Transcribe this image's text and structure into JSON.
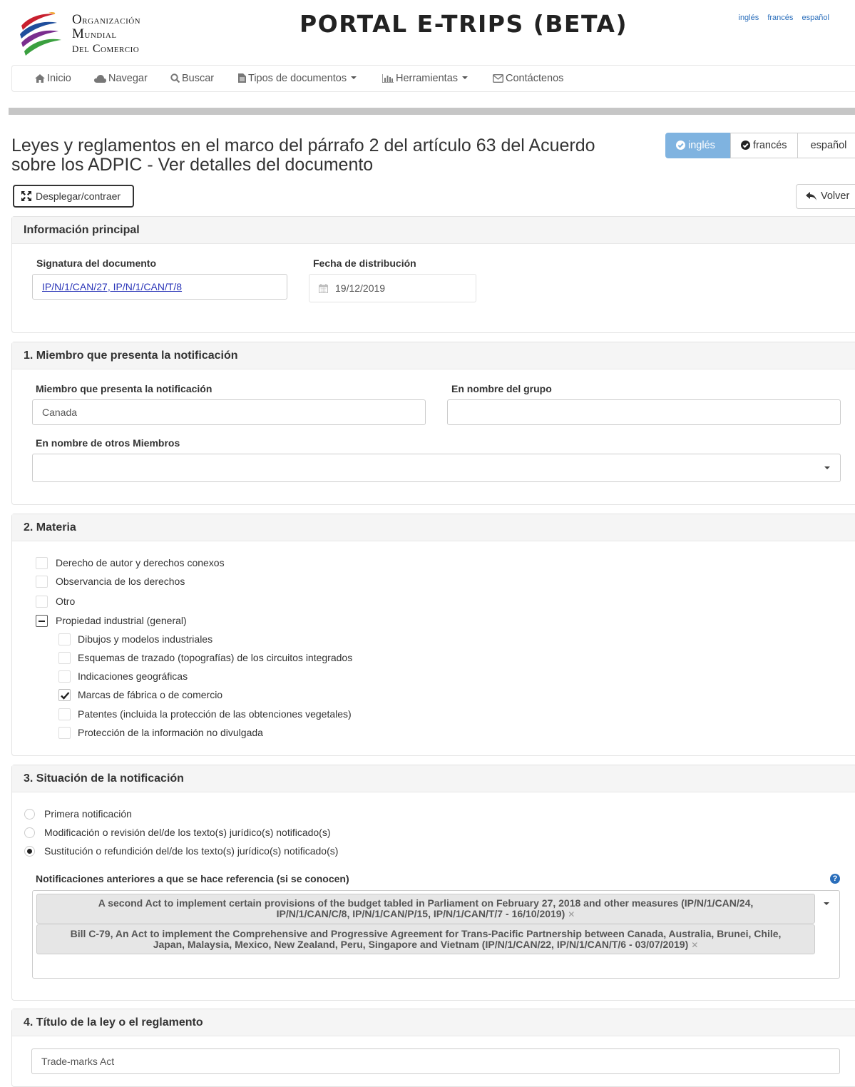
{
  "header": {
    "org_line1": "Organización",
    "org_line2": "Mundial",
    "org_line3": "del Comercio",
    "portal_title": "PORTAL E-TRIPS (BETA)",
    "top_languages": [
      "inglés",
      "francés",
      "español"
    ]
  },
  "nav": {
    "home": "Inicio",
    "browse": "Navegar",
    "search": "Buscar",
    "doc_types": "Tipos de documentos",
    "tools": "Herramientas",
    "contact": "Contáctenos"
  },
  "page": {
    "title": "Leyes y reglamentos en el marco del párrafo 2 del artículo 63 del Acuerdo sobre los ADPIC - Ver detalles del documento",
    "lang_buttons": {
      "english": "inglés",
      "french": "francés",
      "spanish": "español"
    },
    "toggle_button": "Desplegar/contraer",
    "back_button": "Volver"
  },
  "main_info": {
    "heading": "Información principal",
    "signature_label": "Signatura del documento",
    "signature_value": "IP/N/1/CAN/27, IP/N/1/CAN/T/8",
    "date_label": "Fecha de distribución",
    "date_value": "19/12/2019"
  },
  "section1": {
    "heading": "1. Miembro que presenta la notificación",
    "member_label": "Miembro que presenta la notificación",
    "member_value": "Canada",
    "group_label": "En nombre del grupo",
    "group_value": "",
    "others_label": "En nombre de otros Miembros",
    "others_value": ""
  },
  "section2": {
    "heading": "2. Materia",
    "items": [
      {
        "label": "Derecho de autor y derechos conexos",
        "state": "unchecked"
      },
      {
        "label": "Observancia de los derechos",
        "state": "unchecked"
      },
      {
        "label": "Otro",
        "state": "unchecked"
      },
      {
        "label": "Propiedad industrial (general)",
        "state": "partial"
      }
    ],
    "subitems": [
      {
        "label": "Dibujos y modelos industriales",
        "state": "unchecked"
      },
      {
        "label": "Esquemas de trazado (topografías) de los circuitos integrados",
        "state": "unchecked"
      },
      {
        "label": "Indicaciones geográficas",
        "state": "unchecked"
      },
      {
        "label": "Marcas de fábrica o de comercio",
        "state": "checked"
      },
      {
        "label": "Patentes (incluida la protección de las obtenciones vegetales)",
        "state": "unchecked"
      },
      {
        "label": "Protección de la información no divulgada",
        "state": "unchecked"
      }
    ]
  },
  "section3": {
    "heading": "3. Situación de la notificación",
    "options": [
      {
        "label": "Primera notificación",
        "selected": false
      },
      {
        "label": "Modificación o revisión del/de los texto(s) jurídico(s) notificado(s)",
        "selected": false
      },
      {
        "label": "Sustitución o refundición del/de los texto(s) jurídico(s) notificado(s)",
        "selected": true
      }
    ],
    "previous_label": "Notificaciones anteriores a que se hace referencia (si se conocen)",
    "previous_tags": [
      {
        "line1": "A second Act to implement certain provisions of the budget tabled in Parliament on February 27, 2018 and other measures (IP/N/1/CAN/24,",
        "line2": "IP/N/1/CAN/C/8, IP/N/1/CAN/P/15, IP/N/1/CAN/T/7 - 16/10/2019)"
      },
      {
        "line1": "Bill C-79, An Act to implement the Comprehensive and Progressive Agreement for Trans-Pacific Partnership between Canada, Australia, Brunei, Chile,",
        "line2": "Japan, Malaysia, Mexico, New Zealand, Peru, Singapore and Vietnam (IP/N/1/CAN/22, IP/N/1/CAN/T/6 - 03/07/2019)"
      }
    ]
  },
  "section4": {
    "heading": "4. Título de la ley o el reglamento",
    "title_value": "Trade-marks Act"
  }
}
